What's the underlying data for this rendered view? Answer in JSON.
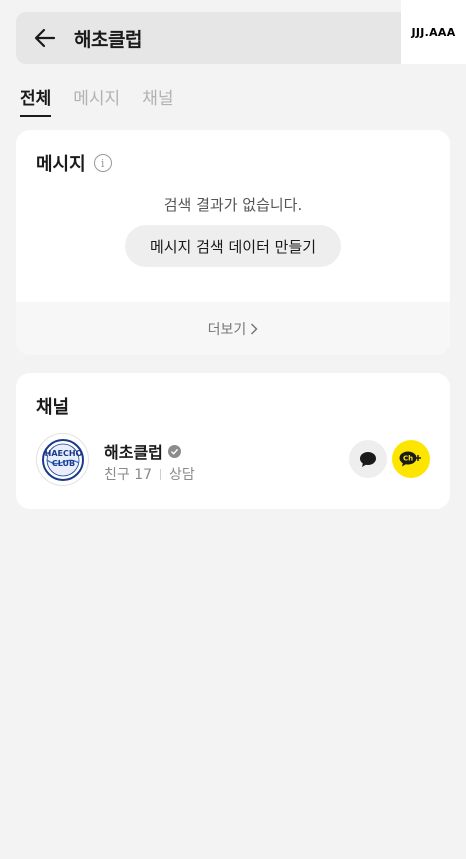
{
  "search": {
    "query": "해초클럽"
  },
  "watermark": "JJJ.AAA",
  "tabs": [
    {
      "label": "전체",
      "active": true
    },
    {
      "label": "메시지",
      "active": false
    },
    {
      "label": "채널",
      "active": false
    }
  ],
  "message_section": {
    "title": "메시지",
    "empty_text": "검색 결과가 없습니다.",
    "make_button_label": "메시지 검색 데이터 만들기",
    "more_label": "더보기"
  },
  "channel_section": {
    "title": "채널",
    "channel": {
      "name": "해초클럽",
      "logo_text_1": "HAECHO",
      "logo_text_2": "CLUB",
      "friends_label": "친구 17",
      "consult_label": "상담",
      "verified": true,
      "add_button_text": "Ch+"
    }
  },
  "colors": {
    "background": "#f3f3f3",
    "card": "#ffffff",
    "accent_yellow": "#fee500",
    "logo_blue": "#1a3a8c"
  }
}
